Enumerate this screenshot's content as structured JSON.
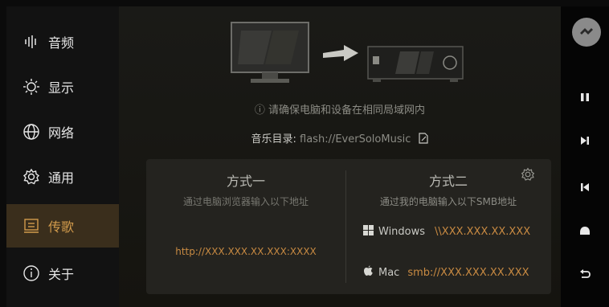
{
  "sidebar": {
    "items": [
      {
        "label": "音频",
        "icon": "audio-wave-icon"
      },
      {
        "label": "显示",
        "icon": "brightness-icon"
      },
      {
        "label": "网络",
        "icon": "globe-icon"
      },
      {
        "label": "通用",
        "icon": "gear-icon"
      },
      {
        "label": "传歌",
        "icon": "transfer-icon",
        "active": true
      },
      {
        "label": "关于",
        "icon": "info-icon"
      }
    ]
  },
  "main": {
    "hint": "ⓘ 请确保电脑和设备在相同局域网内",
    "music_dir_label": "音乐目录:",
    "music_dir_value": "flash://EverSoloMusic",
    "method1": {
      "title": "方式一",
      "subtitle": "通过电脑浏览器输入以下地址",
      "url": "http://XXX.XXX.XX.XXX:XXXX"
    },
    "method2": {
      "title": "方式二",
      "subtitle": "通过我的电脑输入以下SMB地址",
      "windows_label": "Windows",
      "windows_value": "\\\\XXX.XXX.XX.XXX",
      "mac_label": "Mac",
      "mac_value": "smb://XXX.XXX.XX.XXX"
    }
  },
  "rail": {
    "buttons": [
      "pause-icon",
      "next-track-icon",
      "previous-track-icon",
      "eject-icon",
      "back-icon"
    ]
  },
  "colors": {
    "accent": "#c88a42",
    "active_bg": "#3a2e1c"
  }
}
